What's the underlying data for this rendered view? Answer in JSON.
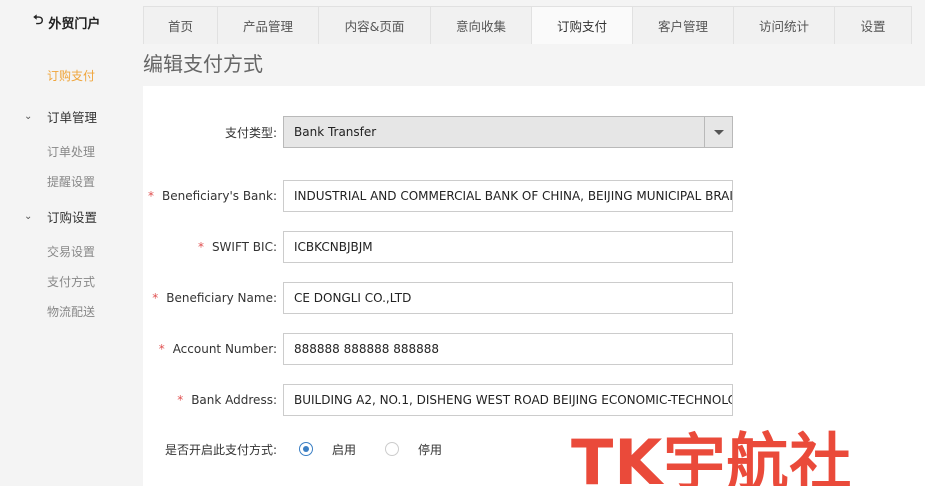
{
  "app": {
    "title": "外贸门户",
    "logo_icon": "⮌"
  },
  "tabs": [
    {
      "label": "首页"
    },
    {
      "label": "产品管理"
    },
    {
      "label": "内容&页面"
    },
    {
      "label": "意向收集"
    },
    {
      "label": "订购支付",
      "active": true
    },
    {
      "label": "客户管理"
    },
    {
      "label": "访问统计"
    },
    {
      "label": "设置"
    }
  ],
  "sidebar": {
    "top_item": "订购支付",
    "groups": [
      {
        "label": "订单管理",
        "items": [
          "订单处理",
          "提醒设置"
        ]
      },
      {
        "label": "订购设置",
        "items": [
          "交易设置",
          "支付方式",
          "物流配送"
        ]
      }
    ],
    "active_item": "支付方式"
  },
  "page": {
    "title": "编辑支付方式"
  },
  "form": {
    "payment_type": {
      "label": "支付类型:",
      "value": "Bank Transfer"
    },
    "beneficiary_bank": {
      "label": "Beneficiary's Bank:",
      "required": "*",
      "value": "INDUSTRIAL AND COMMERCIAL BANK OF CHINA, BEIJING MUNICIPAL BRAI"
    },
    "swift_bic": {
      "label": "SWIFT BIC:",
      "required": "*",
      "value": "ICBKCNBJBJM"
    },
    "beneficiary_name": {
      "label": "Beneficiary Name:",
      "required": "*",
      "value": "CE DONGLI CO.,LTD"
    },
    "account_number": {
      "label": "Account Number:",
      "required": "*",
      "value": "888888 888888 888888"
    },
    "bank_address": {
      "label": "Bank Address:",
      "required": "*",
      "value": "BUILDING A2, NO.1, DISHENG WEST ROAD BEIJING ECONOMIC-TECHNOLO"
    },
    "enable": {
      "label": "是否开启此支付方式:",
      "options": [
        "启用",
        "停用"
      ],
      "selected": "启用"
    }
  },
  "watermark": "TK宇航社",
  "colors": {
    "accent": "#f0a53b",
    "radio": "#3b7fc4",
    "required": "#e05050",
    "watermark": "#ea4a3a"
  }
}
